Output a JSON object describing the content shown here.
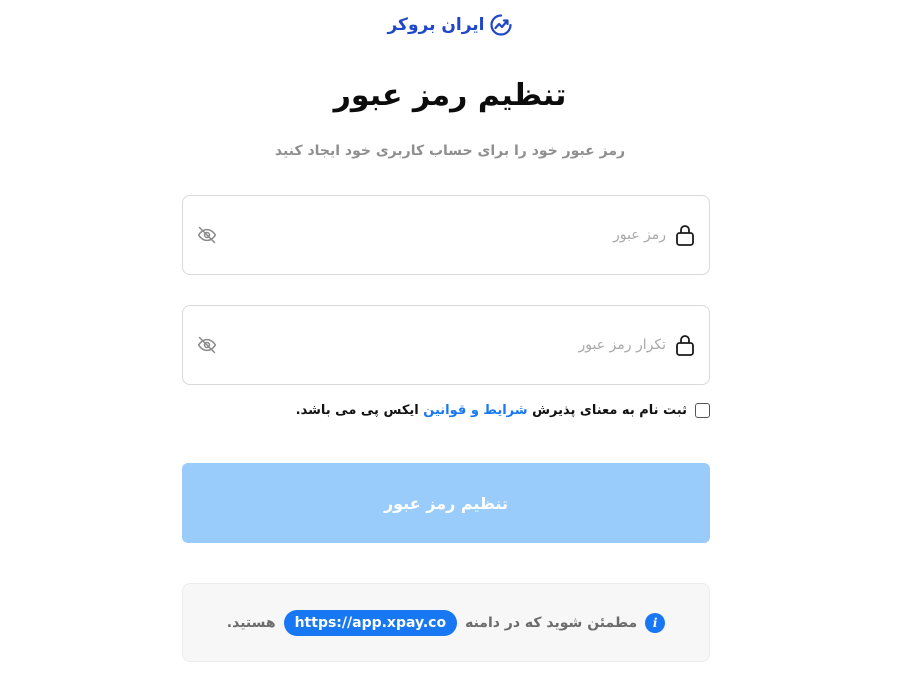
{
  "brand": {
    "name": "ایران بروکر",
    "color": "#1f47c9",
    "icon": "trend-chart-logo-icon"
  },
  "page": {
    "title": "تنظیم رمز عبور",
    "subtitle": "رمز عبور خود را برای حساب کاربری خود ایجاد کنید"
  },
  "form": {
    "password": {
      "placeholder": "رمز عبور",
      "value": "",
      "icon": "lock-icon",
      "toggle_icon": "eye-off-icon"
    },
    "confirm_password": {
      "placeholder": "تکرار رمز عبور",
      "value": "",
      "icon": "lock-icon",
      "toggle_icon": "eye-off-icon"
    },
    "terms": {
      "checked": false,
      "prefix": "ثبت نام به معنای پذیرش",
      "link": "شرایط و قوانین",
      "suffix": "ایکس پی می باشد."
    },
    "submit_label": "تنظیم رمز عبور",
    "submit_color": "#99ccfb"
  },
  "notice": {
    "icon": "info-icon",
    "prefix": "مطمئن شوید که در دامنه",
    "domain": "https://app.xpay.co",
    "suffix": "هستید.",
    "accent": "#1877f2"
  }
}
